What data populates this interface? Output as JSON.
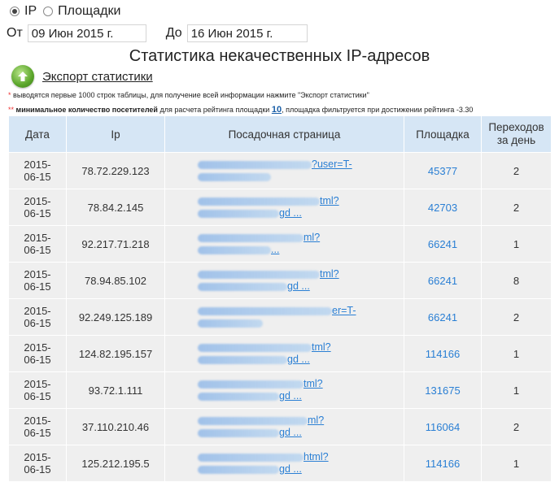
{
  "mode": {
    "options": [
      "IP",
      "Площадки"
    ],
    "selected": "IP"
  },
  "dates": {
    "from_label": "От",
    "from_value": "09 Июн 2015 г.",
    "to_label": "До",
    "to_value": "16 Июн 2015 г."
  },
  "title": "Статистика некачественных IP-адресов",
  "export": {
    "label": "Экспорт статистики",
    "icon": "arrow-up-icon"
  },
  "notes": {
    "note1_star": "*",
    "note1": "выводятся первые 1000 строк таблицы, для получение всей информации нажмите \"Экспорт статистики\"",
    "note2_star": "**",
    "note2_bold": "минимальное количество посетителей",
    "note2_mid": "для расчета рейтинга площадки",
    "note2_num": "10",
    "note2_tail": ", площадка фильтруется при достижении рейтинга -3.30"
  },
  "table": {
    "headers": {
      "date": "Дата",
      "ip": "Ip",
      "page": "Посадочная страница",
      "site": "Площадка",
      "visits": "Переходов за день"
    },
    "rows": [
      {
        "date": "2015-06-15",
        "ip": "78.72.229.123",
        "page1": "?user=T-",
        "page2": "",
        "site": "45377",
        "visits": "2"
      },
      {
        "date": "2015-06-15",
        "ip": "78.84.2.145",
        "page1": "tml?",
        "page2": "gd ...",
        "site": "42703",
        "visits": "2"
      },
      {
        "date": "2015-06-15",
        "ip": "92.217.71.218",
        "page1": "ml?",
        "page2": "...",
        "site": "66241",
        "visits": "1"
      },
      {
        "date": "2015-06-15",
        "ip": "78.94.85.102",
        "page1": "tml?",
        "page2": "gd ...",
        "site": "66241",
        "visits": "8"
      },
      {
        "date": "2015-06-15",
        "ip": "92.249.125.189",
        "page1": "er=T-",
        "page2": "",
        "site": "66241",
        "visits": "2"
      },
      {
        "date": "2015-06-15",
        "ip": "124.82.195.157",
        "page1": "tml?",
        "page2": "gd ...",
        "site": "114166",
        "visits": "1"
      },
      {
        "date": "2015-06-15",
        "ip": "93.72.1.111",
        "page1": "tml?",
        "page2": "gd ...",
        "site": "131675",
        "visits": "1"
      },
      {
        "date": "2015-06-15",
        "ip": "37.110.210.46",
        "page1": "ml?",
        "page2": "gd ...",
        "site": "116064",
        "visits": "2"
      },
      {
        "date": "2015-06-15",
        "ip": "125.212.195.5",
        "page1": "html?",
        "page2": "gd ...",
        "site": "114166",
        "visits": "1"
      }
    ]
  }
}
